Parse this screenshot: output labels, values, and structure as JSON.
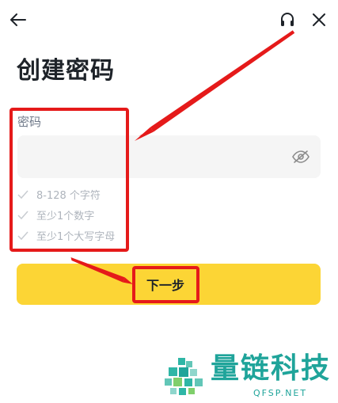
{
  "header": {
    "back_icon": "back-arrow-icon",
    "support_icon": "headset-icon",
    "close_icon": "close-icon"
  },
  "page": {
    "title": "创建密码"
  },
  "password": {
    "label": "密码",
    "value": "",
    "placeholder": "",
    "visibility_icon": "eye-slash-icon"
  },
  "requirements": [
    {
      "text": "8-128 个字符",
      "met": false
    },
    {
      "text": "至少1个数字",
      "met": false
    },
    {
      "text": "至少1个大写字母",
      "met": false
    }
  ],
  "next_button": {
    "label": "下一步"
  },
  "watermark": {
    "title": "量链科技",
    "subtitle": "QFSP.NET"
  },
  "colors": {
    "accent": "#FCD535",
    "text_primary": "#1E2329",
    "text_secondary": "#707A8A",
    "annotation": "#E51A1A",
    "watermark": "#1FA49A"
  }
}
